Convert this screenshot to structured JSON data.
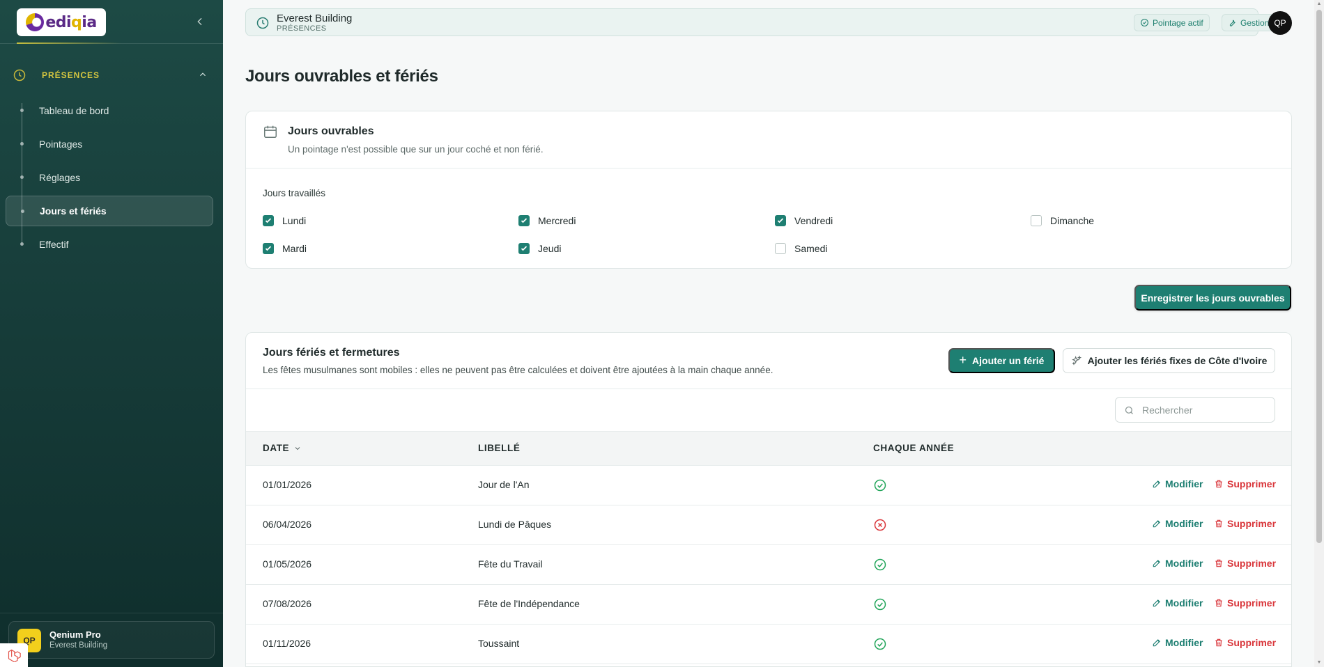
{
  "sidebar": {
    "logo_text": "ediqia",
    "section_label": "PRÉSENCES",
    "items": [
      {
        "label": "Tableau de bord",
        "active": false
      },
      {
        "label": "Pointages",
        "active": false
      },
      {
        "label": "Réglages",
        "active": false
      },
      {
        "label": "Jours et fériés",
        "active": true
      },
      {
        "label": "Effectif",
        "active": false
      }
    ],
    "user": {
      "initials": "QP",
      "name": "Qenium Pro",
      "company": "Everest Building"
    }
  },
  "topbar": {
    "title": "Everest Building",
    "subtitle": "PRÉSENCES",
    "pointage_chip": "Pointage actif",
    "gestion_chip": "Gestion",
    "avatar_initials": "QP"
  },
  "page": {
    "title": "Jours ouvrables et fériés"
  },
  "working_days": {
    "title": "Jours ouvrables",
    "subtitle": "Un pointage n'est possible que sur un jour coché et non férié.",
    "label": "Jours travaillés",
    "days": [
      {
        "label": "Lundi",
        "checked": true
      },
      {
        "label": "Mardi",
        "checked": true
      },
      {
        "label": "Mercredi",
        "checked": true
      },
      {
        "label": "Jeudi",
        "checked": true
      },
      {
        "label": "Vendredi",
        "checked": true
      },
      {
        "label": "Samedi",
        "checked": false
      },
      {
        "label": "Dimanche",
        "checked": false
      }
    ],
    "save_button": "Enregistrer les jours ouvrables"
  },
  "holidays": {
    "title": "Jours fériés et fermetures",
    "subtitle": "Les fêtes musulmanes sont mobiles : elles ne peuvent pas être calculées et doivent être ajoutées à la main chaque année.",
    "add_button": "Ajouter un férié",
    "fixed_button": "Ajouter les fériés fixes de Côte d'Ivoire",
    "search_placeholder": "Rechercher",
    "columns": {
      "date": "DATE",
      "label": "LIBELLÉ",
      "yearly": "CHAQUE ANNÉE"
    },
    "edit_label": "Modifier",
    "delete_label": "Supprimer",
    "rows": [
      {
        "date": "01/01/2026",
        "label": "Jour de l'An",
        "yearly": true
      },
      {
        "date": "06/04/2026",
        "label": "Lundi de Pâques",
        "yearly": false
      },
      {
        "date": "01/05/2026",
        "label": "Fête du Travail",
        "yearly": true
      },
      {
        "date": "07/08/2026",
        "label": "Fête de l'Indépendance",
        "yearly": true
      },
      {
        "date": "01/11/2026",
        "label": "Toussaint",
        "yearly": true
      }
    ]
  },
  "colors": {
    "primary": "#1e7f72",
    "danger": "#d9353a",
    "success": "#22a55a",
    "sidebar": "#173d3a",
    "accent": "#d5c640"
  }
}
